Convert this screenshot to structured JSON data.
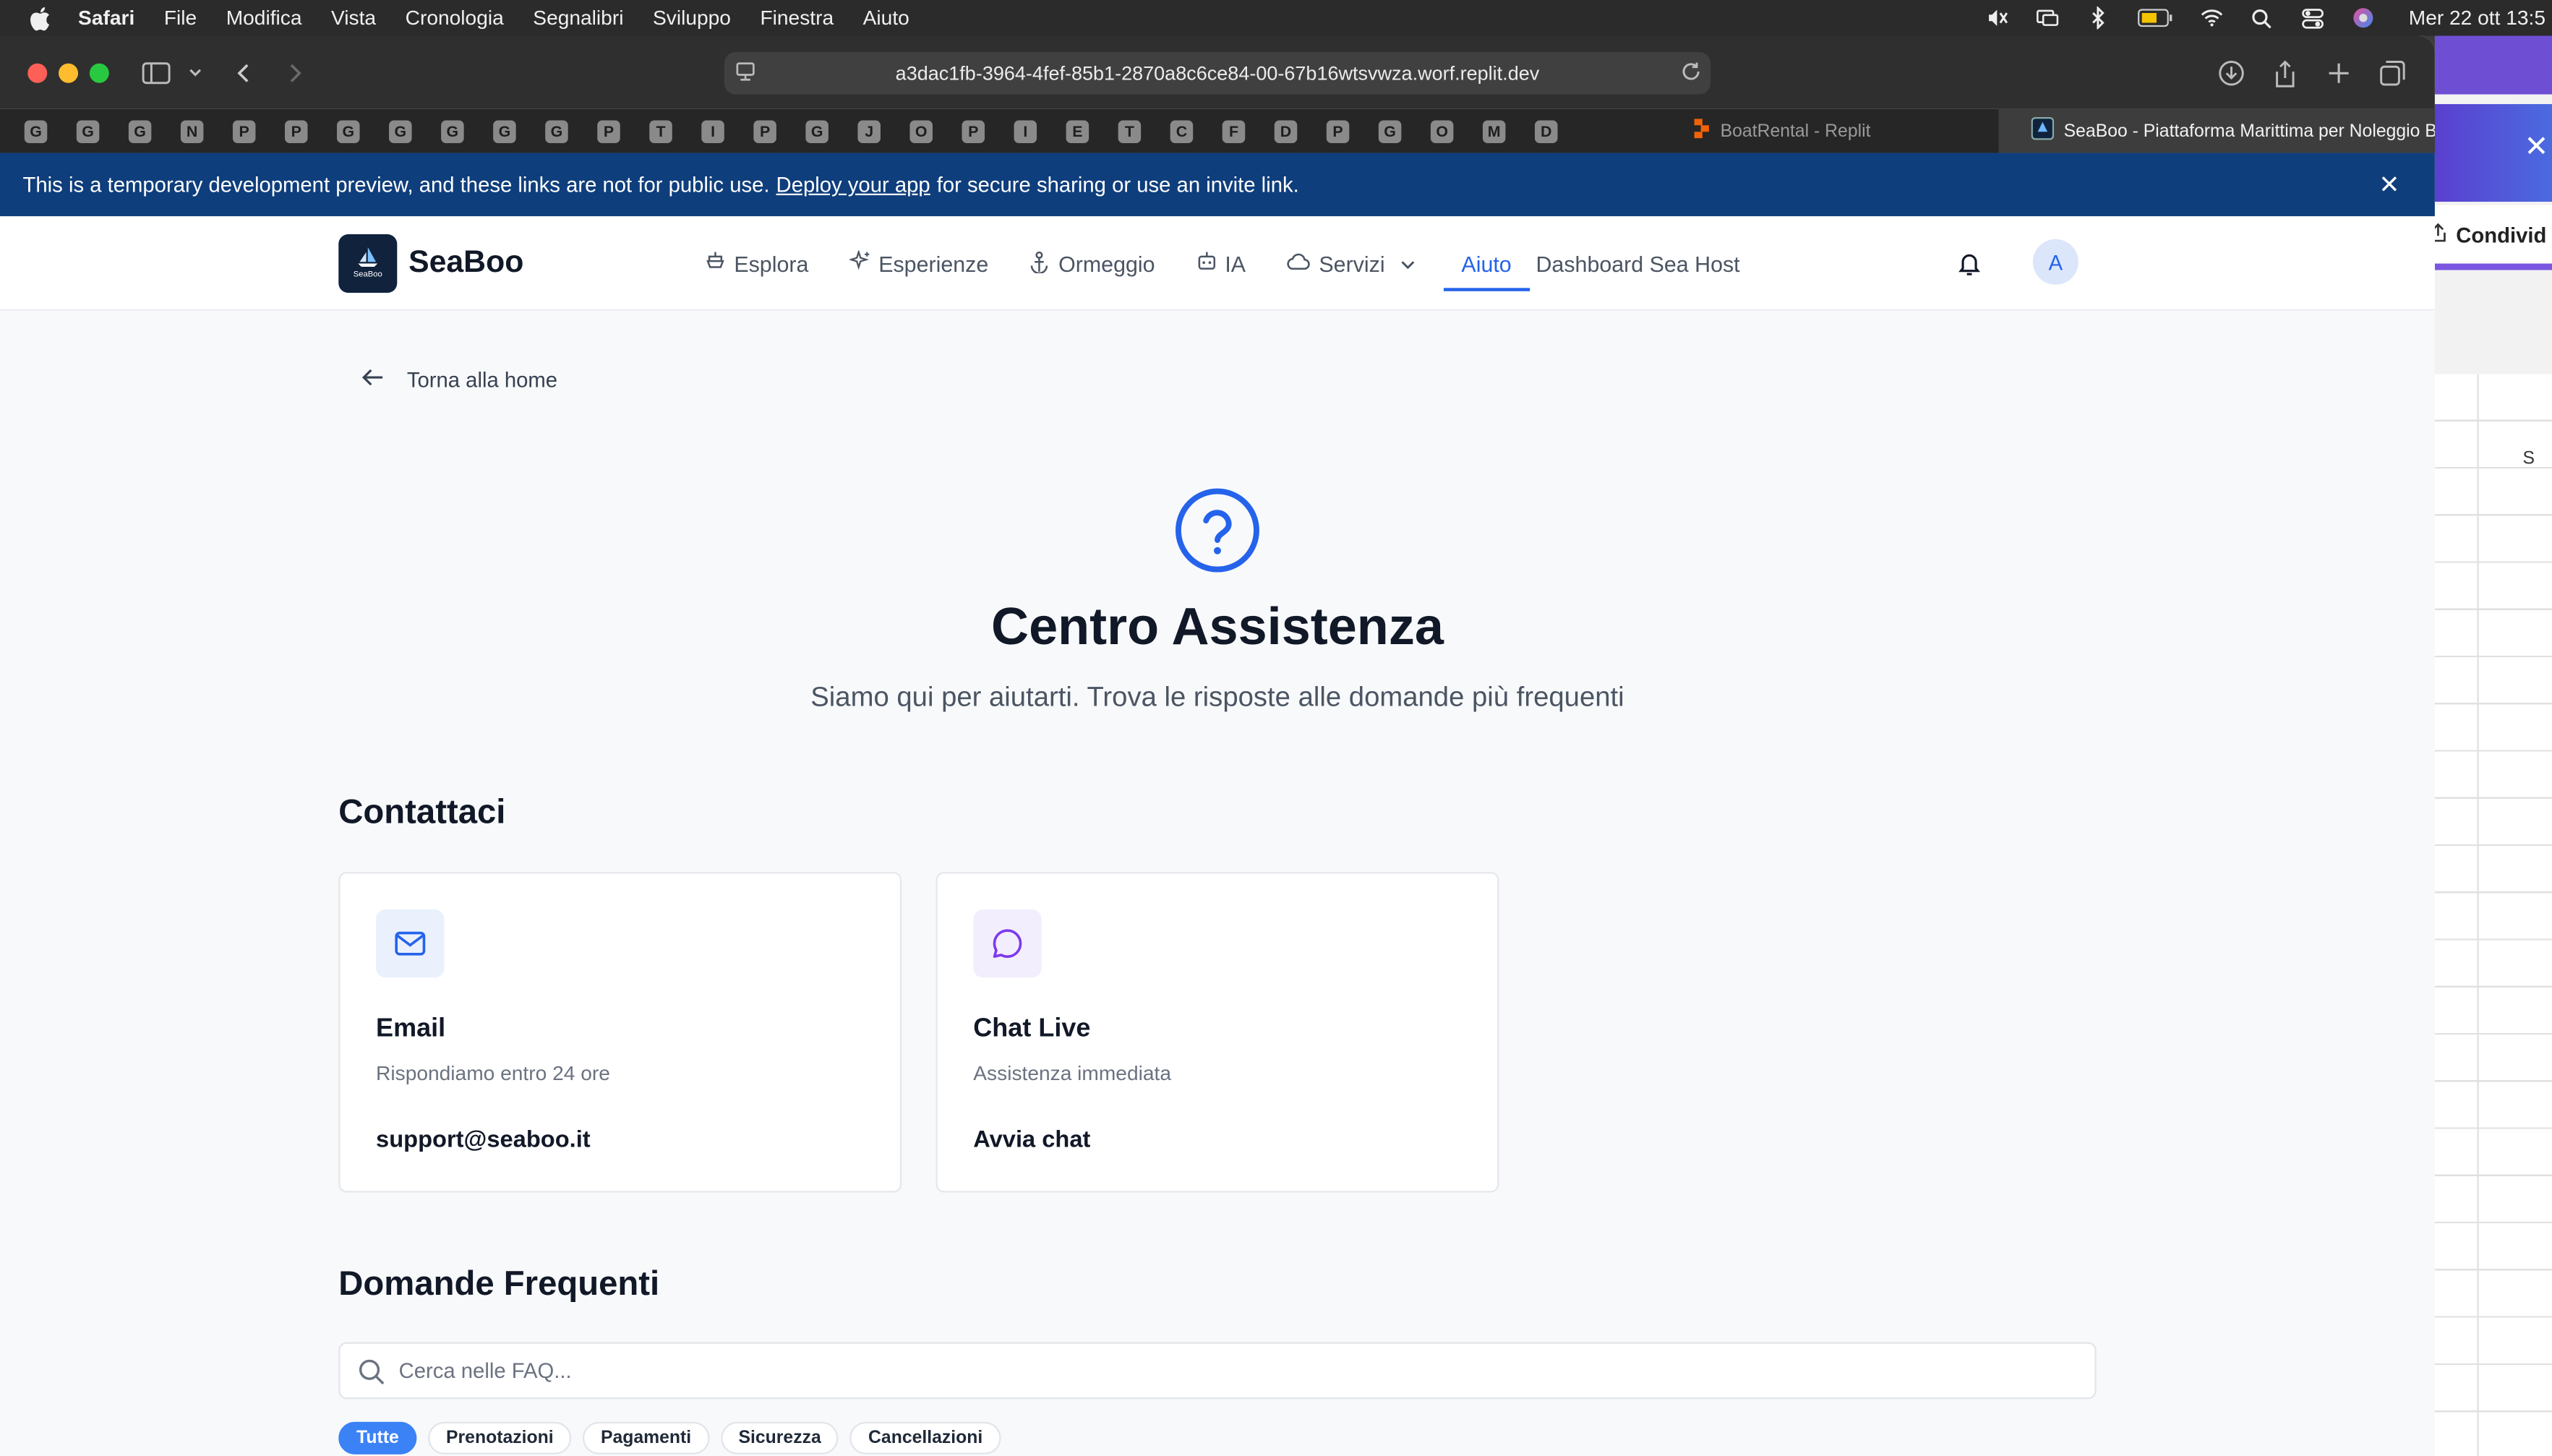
{
  "os_menubar": {
    "app": "Safari",
    "menus": [
      "File",
      "Modifica",
      "Vista",
      "Cronologia",
      "Segnalibri",
      "Sviluppo",
      "Finestra",
      "Aiuto"
    ],
    "clock": "Mer 22 ott  13:5"
  },
  "browser": {
    "url": "a3dac1fb-3964-4fef-85b1-2870a8c6ce84-00-67b16wtsvwza.worf.replit.dev",
    "favorites": [
      "G",
      "G",
      "G",
      "N",
      "P",
      "P",
      "G",
      "G",
      "G",
      "G",
      "G",
      "P",
      "T",
      "I",
      "P",
      "G",
      "J",
      "O",
      "P",
      "I",
      "E",
      "T",
      "C",
      "F",
      "D",
      "P",
      "G",
      "O",
      "M",
      "D"
    ],
    "tabs": [
      {
        "label": "BoatRental - Replit"
      },
      {
        "label": "SeaBoo - Piattaforma Marittima per Noleggio B..."
      }
    ]
  },
  "banner": {
    "text_before": "This is a temporary development preview, and these links are not for public use.",
    "link": "Deploy your app",
    "text_after": "for secure sharing or use an invite link."
  },
  "side_window": {
    "share_label": "Condivid",
    "column_letter": "S"
  },
  "header": {
    "logo_text": "SeaBoo",
    "brand": "SeaBoo",
    "nav": [
      {
        "label": "Esplora",
        "icon": "boat-icon"
      },
      {
        "label": "Esperienze",
        "icon": "sparkles-icon"
      },
      {
        "label": "Ormeggio",
        "icon": "anchor-icon"
      },
      {
        "label": "IA",
        "icon": "bot-icon"
      },
      {
        "label": "Servizi",
        "icon": "cloud-icon"
      },
      {
        "label": "Aiuto"
      },
      {
        "label": "Dashboard Sea Host"
      }
    ],
    "active_nav": "Aiuto",
    "avatar_initial": "A"
  },
  "page": {
    "back_label": "Torna alla home",
    "title": "Centro Assistenza",
    "subtitle": "Siamo qui per aiutarti. Trova le risposte alle domande più frequenti",
    "contact_heading": "Contattaci",
    "contacts": [
      {
        "title": "Email",
        "description": "Rispondiamo entro 24 ore",
        "action": "support@seaboo.it",
        "icon": "mail-icon",
        "color": "#2563eb",
        "bg": "#eaf1fd"
      },
      {
        "title": "Chat Live",
        "description": "Assistenza immediata",
        "action": "Avvia chat",
        "icon": "chat-icon",
        "color": "#7c3aed",
        "bg": "#f3eefe"
      }
    ],
    "faq_heading": "Domande Frequenti",
    "search_placeholder": "Cerca nelle FAQ...",
    "categories": [
      "Tutte",
      "Prenotazioni",
      "Pagamenti",
      "Sicurezza",
      "Cancellazioni"
    ],
    "active_category": "Tutte"
  },
  "colors": {
    "accent": "#2563eb",
    "banner": "#0f3e7c",
    "logo_bg": "#10223c"
  }
}
